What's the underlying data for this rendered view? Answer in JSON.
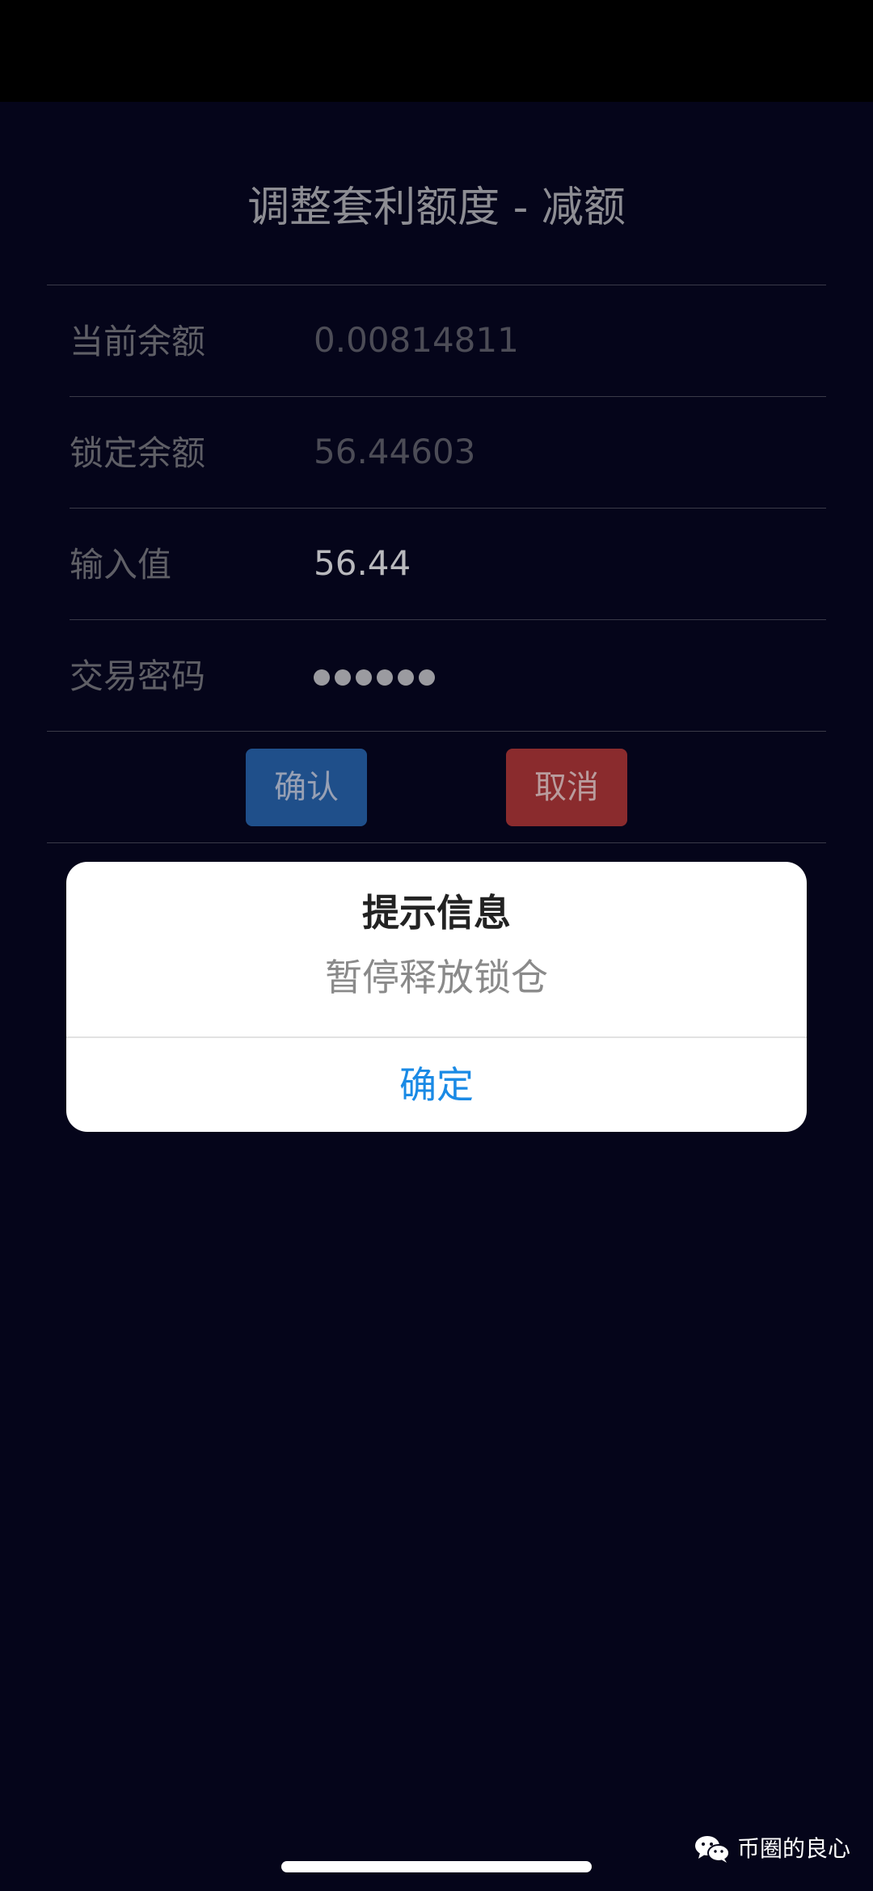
{
  "page": {
    "title": "调整套利额度 - 减额"
  },
  "form": {
    "rows": [
      {
        "label": "当前余额",
        "value": "0.00814811"
      },
      {
        "label": "锁定余额",
        "value": "56.44603"
      },
      {
        "label": "输入值",
        "value": "56.44"
      },
      {
        "label": "交易密码",
        "value": "●●●●●●"
      }
    ],
    "confirm_label": "确认",
    "cancel_label": "取消"
  },
  "dialog": {
    "title": "提示信息",
    "message": "暂停释放锁仓",
    "ok_label": "确定"
  },
  "watermark": {
    "icon": "wechat-icon",
    "text": "币圈的良心"
  },
  "colors": {
    "background": "#05051a",
    "confirm_button": "#1f4f8a",
    "cancel_button": "#8a2b2d",
    "dialog_action": "#1a8ae5"
  }
}
